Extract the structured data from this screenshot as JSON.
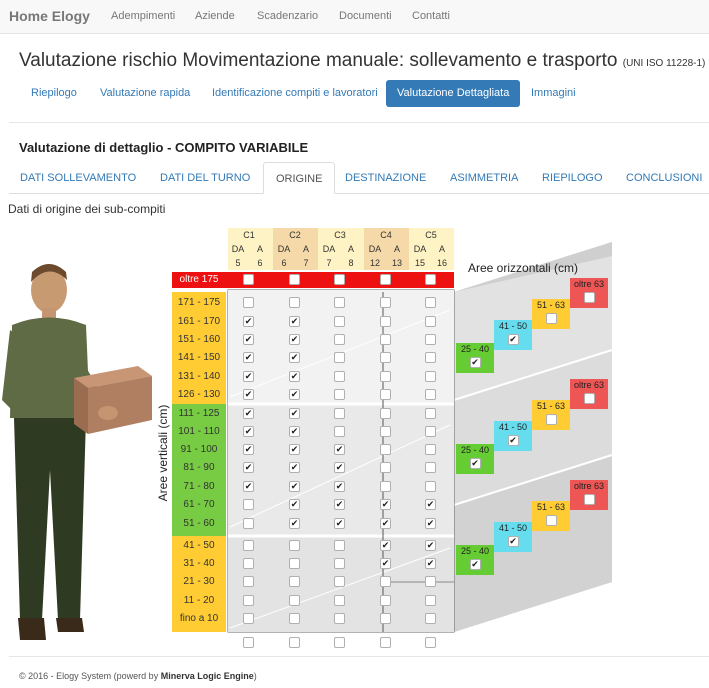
{
  "nav": {
    "brand": "Home Elogy",
    "items": [
      "Adempimenti",
      "Aziende",
      "Scadenzario",
      "Documenti",
      "Contatti"
    ]
  },
  "page": {
    "title": "Valutazione rischio Movimentazione manuale: sollevamento e trasporto",
    "standard": "(UNI ISO 11228-1)"
  },
  "pills": [
    "Riepilogo",
    "Valutazione rapida",
    "Identificazione compiti e lavoratori",
    "Valutazione Dettagliata",
    "Immagini"
  ],
  "section_title": "Valutazione di dettaglio - COMPITO VARIABILE",
  "tabs": [
    "DATI SOLLEVAMENTO",
    "DATI DEL TURNO",
    "ORIGINE",
    "DESTINAZIONE",
    "ASIMMETRIA",
    "RIEPILOGO",
    "CONCLUSIONI"
  ],
  "subtitle": "Dati di origine dei sub-compiti",
  "grid": {
    "columns": [
      {
        "name": "C1",
        "da": "5",
        "a": "6"
      },
      {
        "name": "C2",
        "da": "6",
        "a": "7"
      },
      {
        "name": "C3",
        "da": "7",
        "a": "8"
      },
      {
        "name": "C4",
        "da": "12",
        "a": "13"
      },
      {
        "name": "C5",
        "da": "15",
        "a": "16"
      }
    ],
    "da_label": "DA",
    "a_label": "A",
    "vertical_title": "Aree verticali (cm)",
    "horizontal_title": "Aree orizzontali (cm)",
    "rows": [
      {
        "label": "oltre 175",
        "checks": [
          false,
          false,
          false,
          false,
          false
        ]
      },
      {
        "label": "171 - 175",
        "checks": [
          false,
          false,
          false,
          false,
          false
        ]
      },
      {
        "label": "161 - 170",
        "checks": [
          true,
          true,
          false,
          false,
          false
        ]
      },
      {
        "label": "151 - 160",
        "checks": [
          true,
          true,
          false,
          false,
          false
        ]
      },
      {
        "label": "141 - 150",
        "checks": [
          true,
          true,
          false,
          false,
          false
        ]
      },
      {
        "label": "131 - 140",
        "checks": [
          true,
          true,
          false,
          false,
          false
        ]
      },
      {
        "label": "126 - 130",
        "checks": [
          true,
          true,
          false,
          false,
          false
        ]
      },
      {
        "label": "111 - 125",
        "checks": [
          true,
          true,
          false,
          false,
          false
        ]
      },
      {
        "label": "101 - 110",
        "checks": [
          true,
          true,
          false,
          false,
          false
        ]
      },
      {
        "label": "91 - 100",
        "checks": [
          true,
          true,
          true,
          false,
          false
        ]
      },
      {
        "label": "81 - 90",
        "checks": [
          true,
          true,
          true,
          false,
          false
        ]
      },
      {
        "label": "71 - 80",
        "checks": [
          true,
          true,
          true,
          false,
          false
        ]
      },
      {
        "label": "61 - 70",
        "checks": [
          false,
          true,
          true,
          true,
          true
        ]
      },
      {
        "label": "51 - 60",
        "checks": [
          false,
          true,
          true,
          true,
          true
        ]
      },
      {
        "label": "41 - 50",
        "checks": [
          false,
          false,
          false,
          true,
          true
        ]
      },
      {
        "label": "31 - 40",
        "checks": [
          false,
          false,
          false,
          true,
          true
        ]
      },
      {
        "label": "21 - 30",
        "checks": [
          false,
          false,
          false,
          false,
          false
        ]
      },
      {
        "label": "11 - 20",
        "checks": [
          false,
          false,
          false,
          false,
          false
        ]
      },
      {
        "label": "fino a 10",
        "checks": [
          false,
          false,
          false,
          false,
          false
        ]
      }
    ],
    "bottom_checks": [
      false,
      false,
      false,
      false,
      false
    ],
    "horizontal_groups": [
      {
        "items": [
          {
            "label": "25 - 40",
            "checked": true,
            "color": "#66cc33"
          },
          {
            "label": "41 - 50",
            "checked": true,
            "color": "#66ddee"
          },
          {
            "label": "51 - 63",
            "checked": false,
            "color": "#ffcc33"
          },
          {
            "label": "oltre 63",
            "checked": false,
            "color": "#ee5555"
          }
        ]
      },
      {
        "items": [
          {
            "label": "25 - 40",
            "checked": true,
            "color": "#66cc33"
          },
          {
            "label": "41 - 50",
            "checked": true,
            "color": "#66ddee"
          },
          {
            "label": "51 - 63",
            "checked": false,
            "color": "#ffcc33"
          },
          {
            "label": "oltre 63",
            "checked": false,
            "color": "#ee5555"
          }
        ]
      },
      {
        "items": [
          {
            "label": "25 - 40",
            "checked": true,
            "color": "#66cc33"
          },
          {
            "label": "41 - 50",
            "checked": true,
            "color": "#66ddee"
          },
          {
            "label": "51 - 63",
            "checked": false,
            "color": "#ffcc33"
          },
          {
            "label": "oltre 63",
            "checked": false,
            "color": "#ee5555"
          }
        ]
      }
    ]
  },
  "colors": {
    "accent": "#337ab7",
    "red": "#ee1111",
    "yellow": "#ffcc33",
    "green": "#77cc44"
  },
  "footer": {
    "prefix": "© 2016 - Elogy System (powerd by ",
    "engine": "Minerva Logic Engine",
    "suffix": ")"
  }
}
